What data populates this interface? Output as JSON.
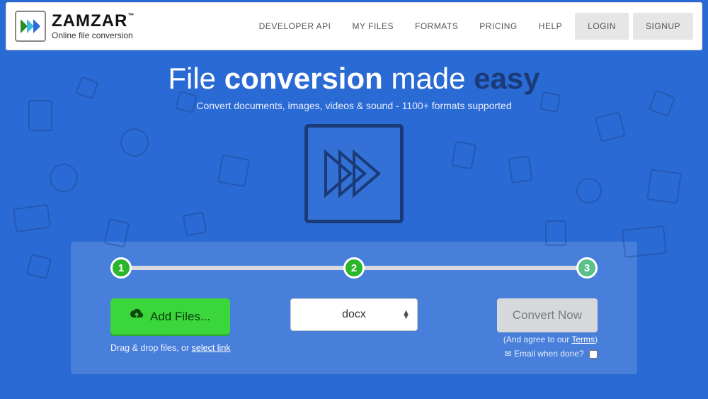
{
  "brand": {
    "name": "ZAMZAR",
    "tm": "™",
    "tagline": "Online file conversion"
  },
  "nav": {
    "api": "DEVELOPER API",
    "files": "MY FILES",
    "formats": "FORMATS",
    "pricing": "PRICING",
    "help": "HELP",
    "login": "LOGIN",
    "signup": "SIGNUP"
  },
  "hero": {
    "t1": "File ",
    "t2": "conversion",
    "t3": " made ",
    "t4": "easy",
    "sub": "Convert documents, images, videos & sound - 1100+ formats supported"
  },
  "steps": {
    "s1": "1",
    "s2": "2",
    "s3": "3"
  },
  "widget": {
    "add": "Add Files...",
    "drag_a": "Drag & drop files, or ",
    "drag_link": "select link",
    "format": "docx",
    "convert": "Convert Now",
    "agree_a": "(And agree to our ",
    "agree_link": "Terms",
    "agree_b": ")",
    "email": "Email when done?",
    "mail_icon": "✉"
  }
}
